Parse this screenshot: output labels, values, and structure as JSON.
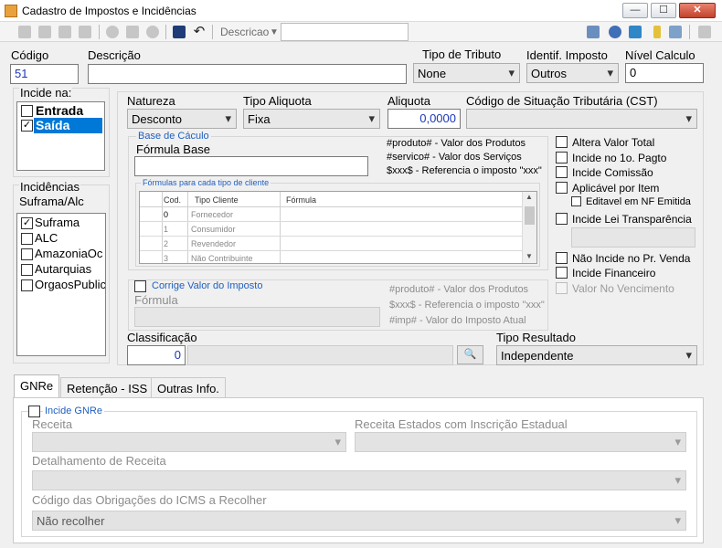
{
  "window": {
    "title": "Cadastro de Impostos e Incidências",
    "minimize": "—",
    "maximize": "☐",
    "close": "✕"
  },
  "toolbar": {
    "search_label": "Descricao",
    "search_value": ""
  },
  "header": {
    "codigo_label": "Código",
    "codigo_value": "51",
    "descricao_label": "Descrição",
    "descricao_value": "",
    "tipo_tributo_label": "Tipo de Tributo",
    "tipo_tributo_value": "None",
    "identif_label": "Identif. Imposto",
    "identif_value": "Outros",
    "nivel_label": "Nível Calculo",
    "nivel_value": "0"
  },
  "incide": {
    "label": "Incide na:",
    "items": [
      {
        "label": "Entrada",
        "checked": false
      },
      {
        "label": "Saída",
        "checked": true
      }
    ]
  },
  "incidencias": {
    "label_line1": "Incidências",
    "label_line2": "Suframa/Alc",
    "items": [
      {
        "label": "Suframa",
        "checked": true
      },
      {
        "label": "ALC",
        "checked": false
      },
      {
        "label": "AmazoniaOc",
        "checked": false
      },
      {
        "label": "Autarquias",
        "checked": false
      },
      {
        "label": "OrgaosPublic",
        "checked": false
      }
    ]
  },
  "main": {
    "natureza_label": "Natureza",
    "natureza_value": "Desconto",
    "tipo_aliquota_label": "Tipo Aliquota",
    "tipo_aliquota_value": "Fixa",
    "aliquota_label": "Aliquota",
    "aliquota_value": "0,0000",
    "cst_label": "Código de Situação Tributária (CST)",
    "cst_value": ""
  },
  "base_calculo": {
    "group_label": "Base de Cáculo",
    "formula_label": "Fórmula Base",
    "formula_value": "",
    "hints": [
      "#produto# - Valor dos Produtos",
      "#servico# - Valor dos Serviços",
      "$xxx$ - Referencia o imposto \"xxx\""
    ],
    "grid_group_label": "Fórmulas para cada tipo de cliente",
    "grid_headers": [
      "Cod.",
      "Tipo Cliente",
      "Fórmula"
    ],
    "grid_rows": [
      {
        "cod": "0",
        "tipo": "Fornecedor",
        "formula": ""
      },
      {
        "cod": "1",
        "tipo": "Consumidor",
        "formula": ""
      },
      {
        "cod": "2",
        "tipo": "Revendedor",
        "formula": ""
      },
      {
        "cod": "3",
        "tipo": "Não Contribuinte",
        "formula": ""
      }
    ]
  },
  "right_options": [
    {
      "label": "Altera Valor Total",
      "checked": false,
      "disabled": false
    },
    {
      "label": "Incide no 1o. Pagto",
      "checked": false,
      "disabled": false
    },
    {
      "label": "Incide Comissão",
      "checked": false,
      "disabled": false
    },
    {
      "label": "Aplicável por Item",
      "checked": false,
      "disabled": false
    },
    {
      "label": "Editavel em NF Emitida",
      "checked": false,
      "disabled": false
    },
    {
      "label": "Incide Lei Transparência",
      "checked": false,
      "disabled": false
    },
    {
      "label": "Não Incide no Pr. Venda",
      "checked": false,
      "disabled": false
    },
    {
      "label": "Incide Financeiro",
      "checked": false,
      "disabled": false
    },
    {
      "label": "Valor No Vencimento",
      "checked": false,
      "disabled": true
    }
  ],
  "corrige": {
    "label": "Corrige Valor do Imposto",
    "formula_label": "Fórmula",
    "formula_value": "",
    "hints": [
      "#produto# - Valor dos Produtos",
      "$xxx$ - Referencia o imposto \"xxx\"",
      "#imp# - Valor do Imposto Atual"
    ]
  },
  "classificacao": {
    "label": "Classificação",
    "value": "0",
    "desc": ""
  },
  "tipo_resultado": {
    "label": "Tipo Resultado",
    "value": "Independente"
  },
  "tabs": [
    {
      "label": "GNRe",
      "active": true
    },
    {
      "label": "Retenção - ISS",
      "active": false
    },
    {
      "label": "Outras Info.",
      "active": false
    }
  ],
  "gnre": {
    "incide_label": "Incide GNRe",
    "receita_label": "Receita",
    "receita_value": "",
    "receita_estados_label": "Receita Estados com Inscrição Estadual",
    "receita_estados_value": "",
    "detalhamento_label": "Detalhamento de Receita",
    "detalhamento_value": "",
    "codigo_obrig_label": "Código das Obrigações do ICMS a Recolher",
    "codigo_obrig_value": "Não recolher"
  }
}
